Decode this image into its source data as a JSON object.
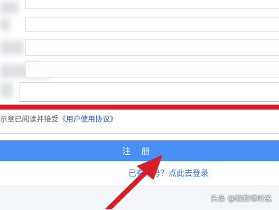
{
  "form": {
    "agreement_prefix": "示意已阅读并接受",
    "agreement_link": "《用户使用协议》",
    "register_label": "注 册",
    "login_link": "已有账号？点此去登录"
  },
  "watermark": {
    "text": "头条 @皎皎喂听说"
  },
  "colors": {
    "highlight": "#d61f2b",
    "button": "#4a8ff3",
    "link": "#2f6fe0"
  }
}
